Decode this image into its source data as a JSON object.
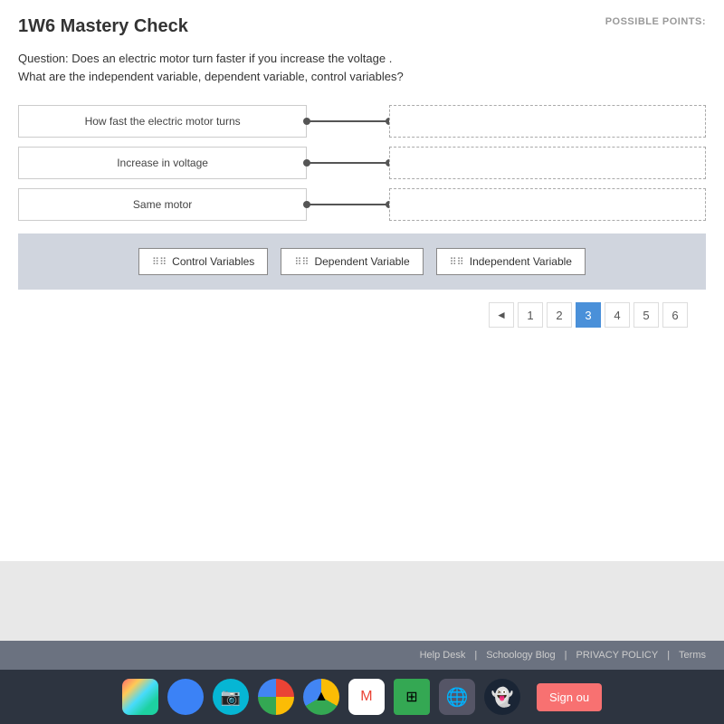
{
  "header": {
    "title": "1W6 Mastery Check",
    "possible_points_label": "POSSIBLE POINTS:"
  },
  "question": {
    "text_line1": "Question: Does an electric motor turn faster if you increase the voltage .",
    "text_line2": "What are the independent variable, dependent variable, control variables?"
  },
  "matching": {
    "left_items": [
      {
        "id": "item1",
        "label": "How fast the electric motor turns"
      },
      {
        "id": "item2",
        "label": "Increase in voltage"
      },
      {
        "id": "item3",
        "label": "Same motor"
      }
    ],
    "right_items": [
      {
        "id": "right1",
        "label": ""
      },
      {
        "id": "right2",
        "label": ""
      },
      {
        "id": "right3",
        "label": ""
      }
    ]
  },
  "drag_items": [
    {
      "id": "drag1",
      "label": "Control Variables"
    },
    {
      "id": "drag2",
      "label": "Dependent Variable"
    },
    {
      "id": "drag3",
      "label": "Independent Variable"
    }
  ],
  "pagination": {
    "arrow_prev": "◄",
    "pages": [
      "1",
      "2",
      "3",
      "4",
      "5",
      "6"
    ],
    "active_page": "3"
  },
  "footer": {
    "links": [
      "Help Desk",
      "|",
      "Schoology Blog",
      "|",
      "PRIVACY POLICY",
      "|",
      "Terms"
    ]
  },
  "taskbar": {
    "sign_out_label": "Sign ou"
  }
}
